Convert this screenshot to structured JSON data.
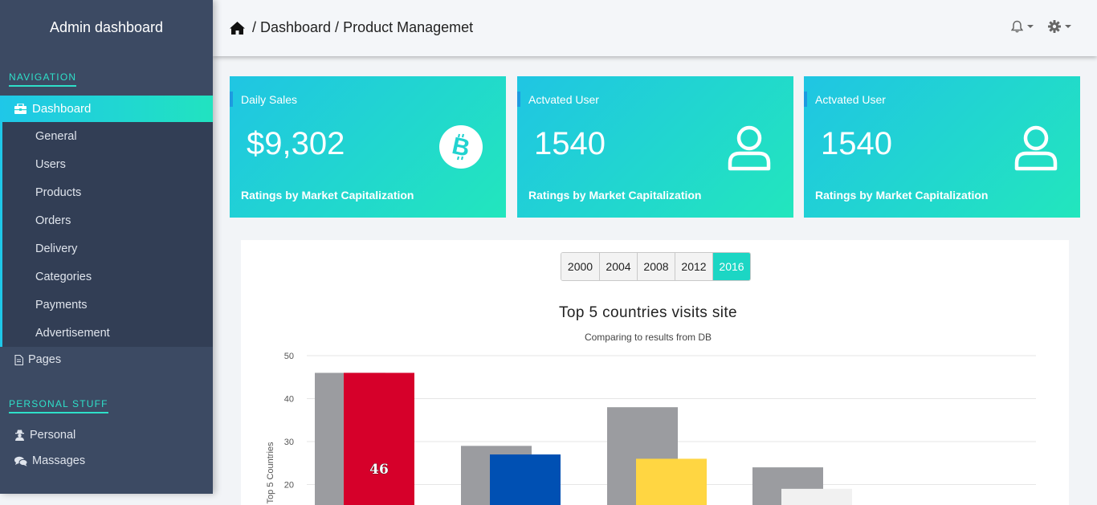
{
  "sidebar": {
    "brand": "Admin dashboard",
    "navigation_label": "NAVIGATION",
    "active_item": "Dashboard",
    "sub_items": [
      "General",
      "Users",
      "Products",
      "Orders",
      "Delivery",
      "Categories",
      "Payments",
      "Advertisement"
    ],
    "pages_label": "Pages",
    "personal_label": "PERSONAL STUFF",
    "personal_items": [
      "Personal",
      "Massages"
    ]
  },
  "header": {
    "breadcrumb": "/ Dashboard / Product Managemet"
  },
  "cards": [
    {
      "label": "Daily Sales",
      "value": "$9,302",
      "footer": "Ratings by Market Capitalization",
      "icon": "bitcoin-icon"
    },
    {
      "label": "Actvated User",
      "value": "1540",
      "footer": "Ratings by Market Capitalization",
      "icon": "user-icon"
    },
    {
      "label": "Actvated User",
      "value": "1540",
      "footer": "Ratings by Market Capitalization",
      "icon": "user-icon"
    }
  ],
  "years": [
    "2000",
    "2004",
    "2008",
    "2012",
    "2016"
  ],
  "selected_year": "2016",
  "colors": {
    "accent": "#1cd6c4",
    "sidebar": "#3c4a63"
  },
  "chart_data": {
    "type": "bar",
    "title": "Top 5 countries visits site",
    "subtitle": "Comparing to results from DB",
    "ylabel": "Top 5 Countries",
    "y_ticks": [
      20,
      30,
      40,
      50
    ],
    "ylim": [
      20,
      50
    ],
    "grid": true,
    "series": [
      {
        "values": [
          46,
          29,
          38,
          24
        ],
        "color": "#9b9ca0"
      },
      {
        "values": [
          46,
          27,
          26,
          19
        ],
        "colors": [
          "#d6002a",
          "#0050b3",
          "#ffd642",
          "#f1f1f1"
        ]
      }
    ],
    "data_labels": [
      "46"
    ]
  }
}
